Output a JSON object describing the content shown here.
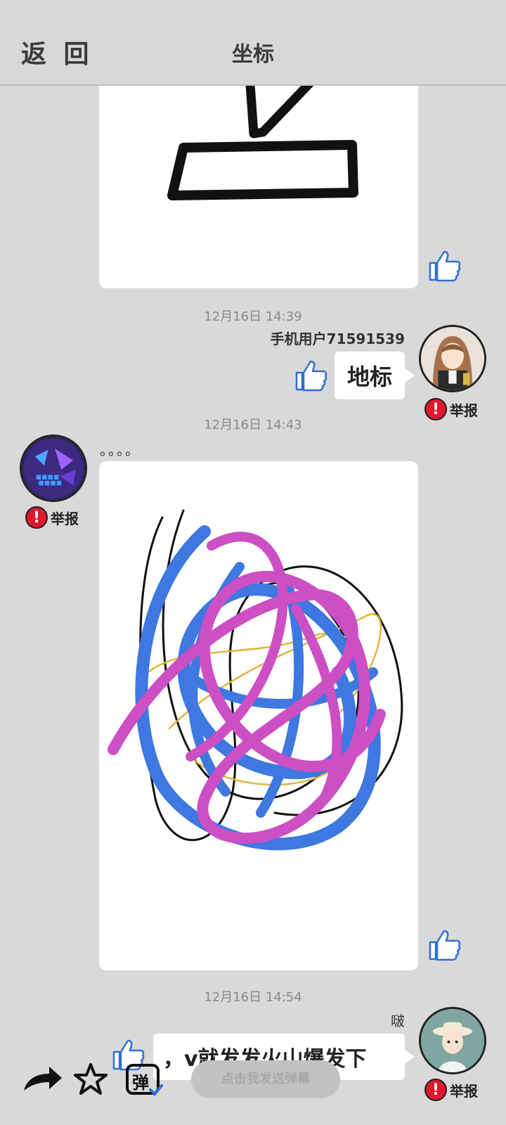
{
  "header": {
    "back_label": "返 回",
    "title": "坐标"
  },
  "messages": [
    {
      "timestamp": "12月16日 14:39",
      "username": "手机用户71591539",
      "text": "地标",
      "report_label": "举报"
    },
    {
      "timestamp": "12月16日 14:43",
      "username": "。。。。",
      "report_label": "举报"
    },
    {
      "timestamp": "12月16日 14:54",
      "username": "啵",
      "text": "，v就发发火山爆发下",
      "report_label": "举报"
    }
  ],
  "bottom_bar": {
    "danmu_icon_label": "弹",
    "danmu_placeholder": "点击我发送弹幕"
  },
  "colors": {
    "background": "#d9d9d9",
    "report_red": "#e0172d",
    "like_blue": "#2f6fd6"
  },
  "icons": [
    "thumbs-up-icon",
    "share-arrow-icon",
    "star-icon",
    "danmu-icon",
    "exclamation-icon"
  ]
}
